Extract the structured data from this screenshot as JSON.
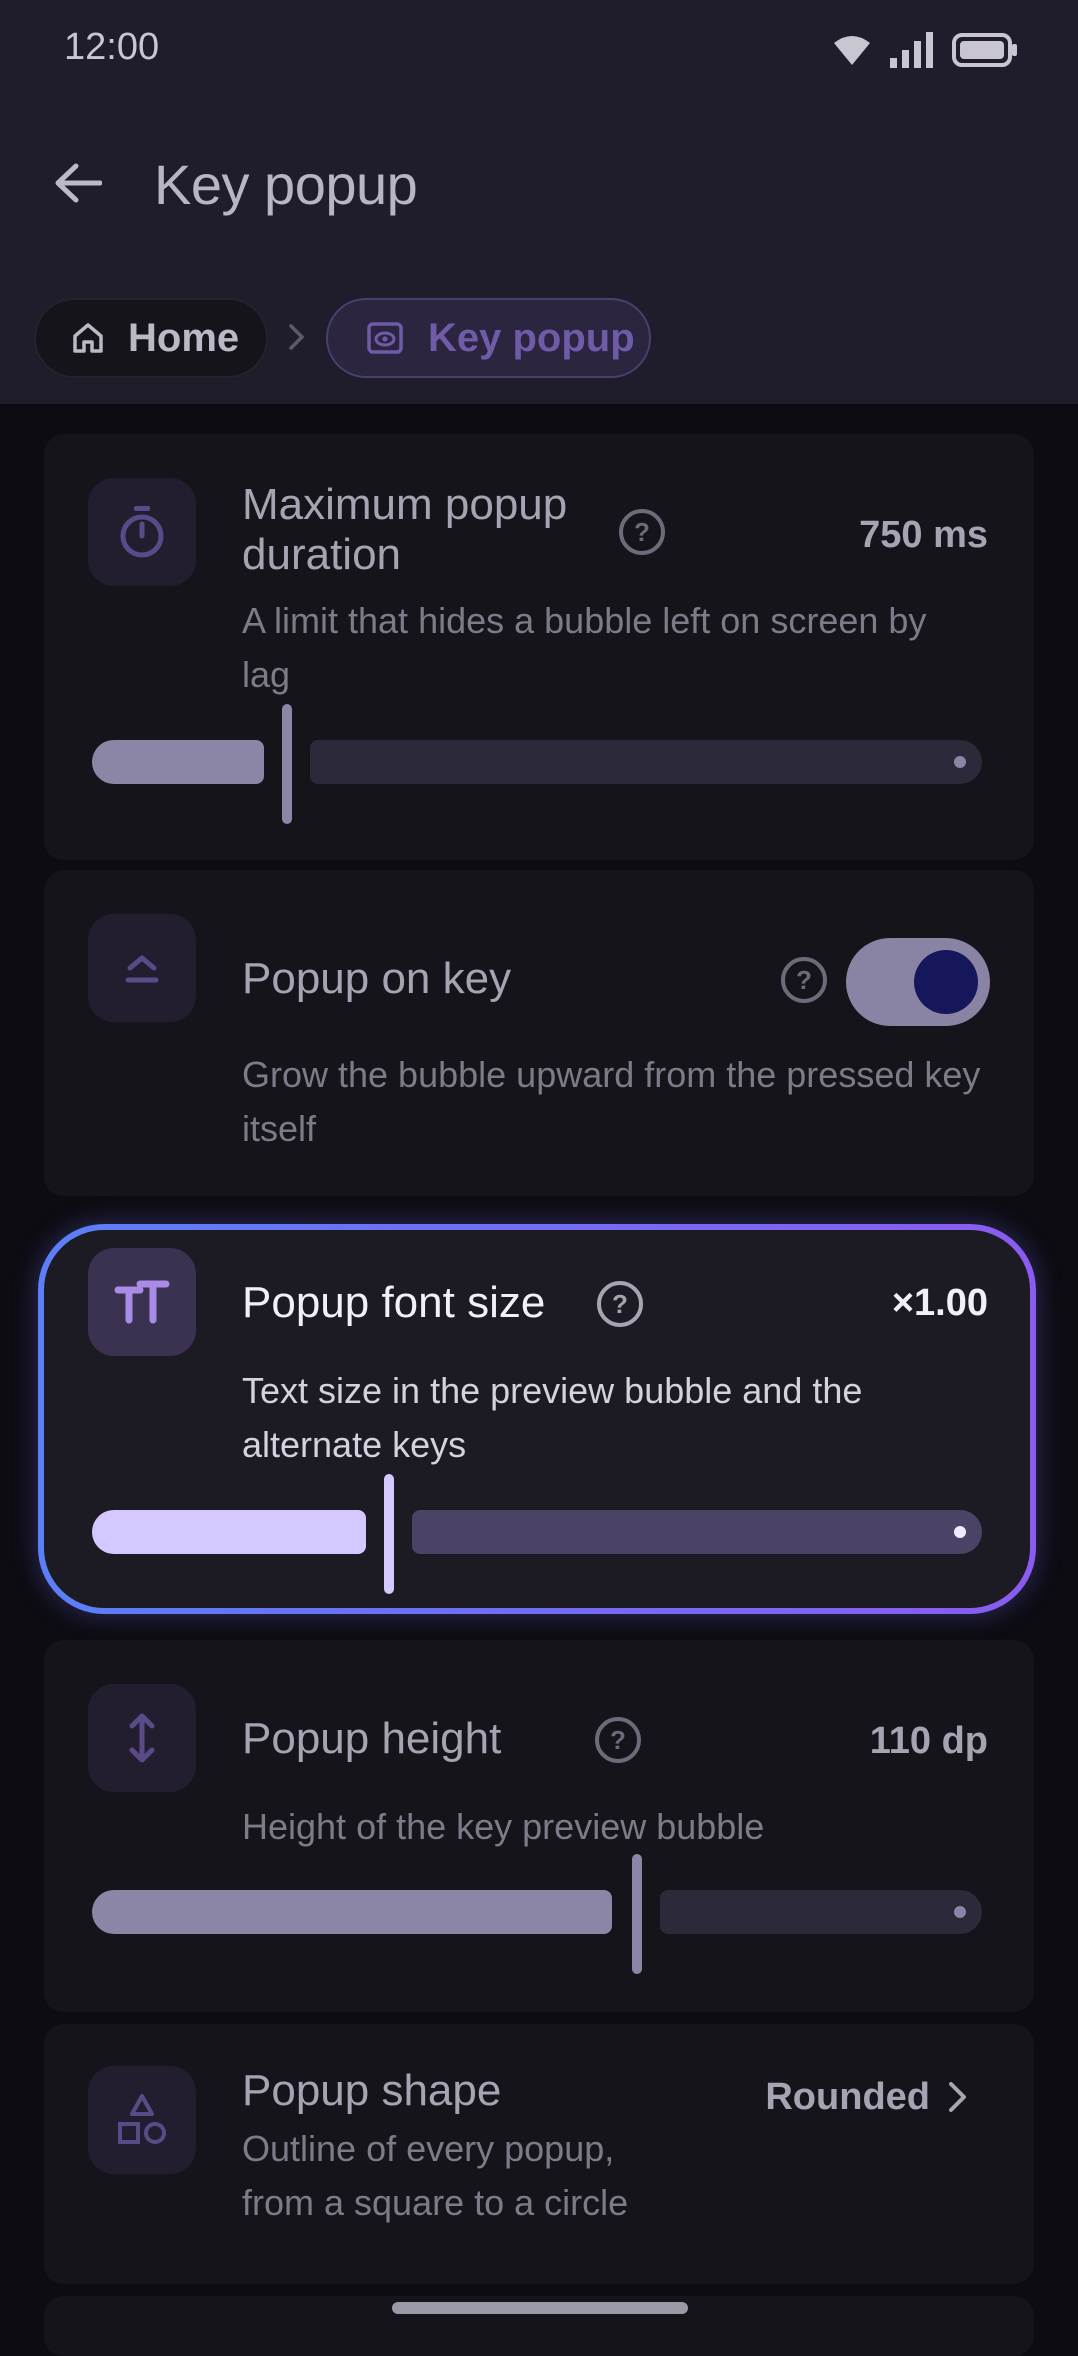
{
  "status_bar": {
    "time": "12:00"
  },
  "app_bar": {
    "title": "Key popup"
  },
  "breadcrumb": {
    "home": "Home",
    "current": "Key popup"
  },
  "settings": [
    {
      "title": "Maximum popup duration",
      "title_line1": "Maximum popup",
      "title_line2": "duration",
      "description": "A limit that hides a bubble left on screen by lag",
      "value": "750 ms",
      "icon": "timer-icon",
      "slider_fraction": 0.2
    },
    {
      "title": "Popup on key",
      "description": "Grow the bubble upward from the pressed key itself",
      "toggle_on": true,
      "icon": "popup-up-icon"
    },
    {
      "title": "Popup font size",
      "description": "Text size in the preview bubble and the alternate keys",
      "value": "×1.00",
      "icon": "text-size-icon",
      "slider_fraction": 0.33,
      "focused": true
    },
    {
      "title": "Popup height",
      "description": "Height of the key preview bubble",
      "value": "110 dp",
      "icon": "vertical-resize-icon",
      "slider_fraction": 0.6
    },
    {
      "title": "Popup shape",
      "description_line1": "Outline of every popup,",
      "description_line2": "from a square to a circle",
      "value": "Rounded",
      "icon": "shapes-icon"
    }
  ],
  "colors": {
    "accent_gradient_start": "#5b7ff6",
    "accent_gradient_end": "#8a5cf0",
    "slider_active_focused": "#d4c8ff",
    "slider_active_dim": "#8c86a6"
  }
}
